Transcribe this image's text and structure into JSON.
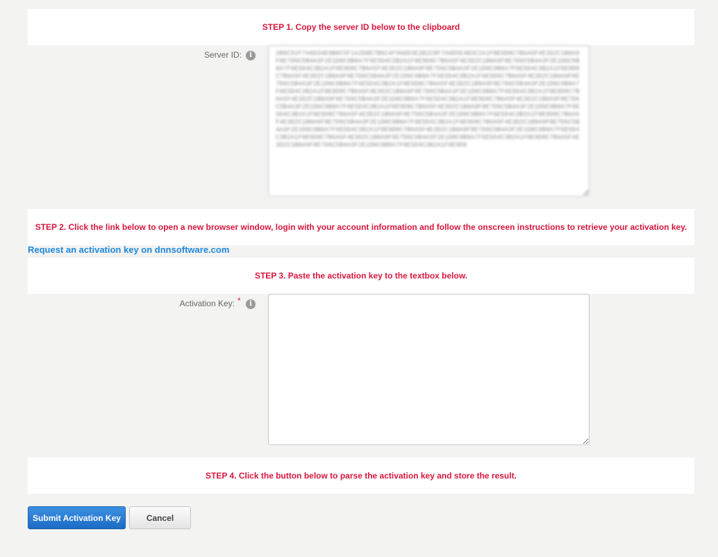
{
  "step1": {
    "lead": "STEP 1.",
    "text": " Copy the server ID below to the clipboard"
  },
  "server_id": {
    "label": "Server ID:",
    "info_icon": "info-icon",
    "value": "2B8C91F7A6D34E9B0C5F1A2D8E7B6C4F9A0D3E2B1C8F7A6D5E4B3C2A1F0E9D8C7B6A5F4E3D2C1B0A9F8E7D6C5B4A3F2E1D0C9B8A7F6E5D4C3B2A1F0E9D8C7B6A5F4E3D2C1B0A9F8E7D6C5B4A3F2E1D0C9B8A7F6E5D4C3B2A1F0E9D8C7B6A5F4E3D2C1B0A9F8E7D6C5B4A3F2E1D0C9B8A7F6E5D4C3B2A1F0E9D8C7B6A5F4E3D2C1B0A9F8E7D6C5B4A3F2E1D0C9B8A7F6E5D4C3B2A1F0E9D8C7B6A5F4E3D2C1B0A9F8E7D6C5B4A3F2E1D0C9B8A7F6E5D4C3B2A1F0E9D8C7B6A5F4E3D2C1B0A9F8E7D6C5B4A3F2E1D0C9B8A7F6E5D4C3B2A1F0E9D8C7B6A5F4E3D2C1B0A9F8E7D6C5B4A3F2E1D0C9B8A7F6E5D4C3B2A1F0E9D8C7B6A5F4E3D2C1B0A9F8E7D6C5B4A3F2E1D0C9B8A7F6E5D4C3B2A1F0E9D8C7B6A5F4E3D2C1B0A9F8E7D6C5B4A3F2E1D0C9B8A7F6E5D4C3B2A1F0E9D8C7B6A5F4E3D2C1B0A9F8E7D6C5B4A3F2E1D0C9B8A7F6E5D4C3B2A1F0E9D8C7B6A5F4E3D2C1B0A9F8E7D6C5B4A3F2E1D0C9B8A7F6E5D4C3B2A1F0E9D8C7B6A5F4E3D2C1B0A9F8E7D6C5B4A3F2E1D0C9B8A7F6E5D4C3B2A1F0E9D8C7B6A5F4E3D2C1B0A9F8E7D6C5B4A3F2E1D0C9B8A7F6E5D4C3B2A1F0E9D8C7B6A5F4E3D2C1B0A9F8E7D6C5B4A3F2E1D0C9B8A7F6E5D4C3B2A1F0E9D8C7B6A5F4E3D2C1B0A9F8E7D6C5B4A3F2E1D0C9B8A7F6E5D4C3B2A1F0E9D8C7B6A5F4E3D2C1B0A9F8E7D6C5B4A3F2E1D0C9B8A7F6E5D4C3B2A1F0E9D8"
  },
  "step2": {
    "lead": "STEP 2.",
    "text": " Click the link below to open a new browser window, login with your account information and follow the onscreen instructions to retrieve your activation key."
  },
  "activation_link": {
    "label": "Request an activation key on dnnsoftware.com"
  },
  "step3": {
    "lead": "STEP 3.",
    "text": " Paste the activation key to the textbox below."
  },
  "activation_key": {
    "label": "Activation Key:",
    "required_mark": "*",
    "info_icon": "info-icon",
    "value": ""
  },
  "step4": {
    "lead": "STEP 4.",
    "text": " Click the button below to parse the activation key and store the result."
  },
  "buttons": {
    "submit_label": "Submit Activation Key",
    "cancel_label": "Cancel"
  },
  "colors": {
    "step_text": "#d6163c",
    "link": "#1e87d9",
    "primary_button": "#1d6cc6",
    "page_background": "#f3f3f2"
  }
}
